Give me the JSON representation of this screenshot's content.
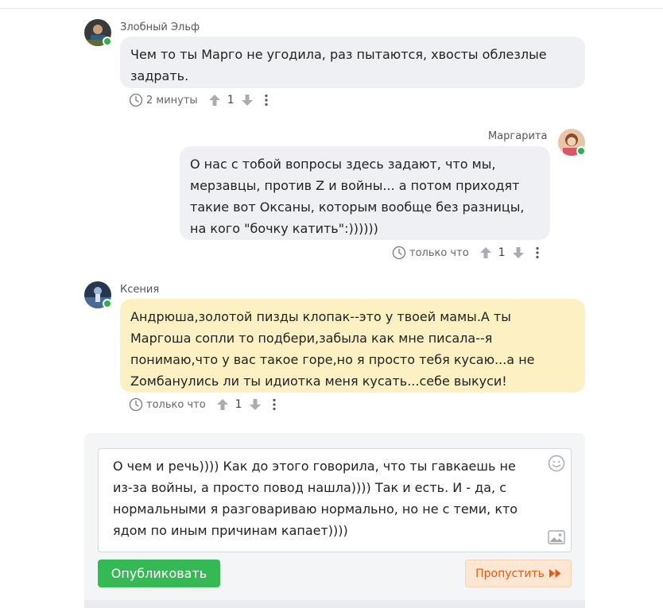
{
  "comments": [
    {
      "author": "Злобный Эльф",
      "text": "Чем то ты Марго не угодила, раз пытаются, хвосты облезлые задрать.",
      "time": "2 минуты",
      "votes": "1",
      "align": "left",
      "bubble_color": "#eef0f3"
    },
    {
      "author": "Маргарита",
      "text": "О нас с тобой вопросы здесь задают, что мы, мерзавцы, против Z и войны... а потом приходят такие вот Оксаны, которым вообще без разницы, на кого \"бочку катить\":))))))",
      "time": "только что",
      "votes": "1",
      "align": "right",
      "bubble_color": "#eef0f3"
    },
    {
      "author": "Ксения",
      "text": "Андрюша,золотой пизды клопак--это у твоей мамы.А ты Маргоша сопли то подбери,забыла как мне писала--я понимаю,что у вас такое горе,но я просто тебя кусаю...а не Zомбанулись ли ты идиотка меня кусать...себе выкуси!",
      "time": "только что",
      "votes": "1",
      "align": "left",
      "bubble_color": "#fdf1c3"
    }
  ],
  "composer": {
    "text": "О чем и речь)))) Как до этого говорила, что ты гавкаешь не из-за войны, а просто повод нашла)))) Так и есть. И - да, с нормальными я разговариваю нормально, но не с теми, кто ядом по иным причинам капает))))",
    "publish_label": "Опубликовать",
    "skip_label": "Пропустить"
  },
  "colors": {
    "accent_green": "#35b955",
    "skip_orange": "#e55a12",
    "online": "#2bb24c"
  },
  "icons": {
    "clock": "clock-icon",
    "upvote": "arrow-up-icon",
    "downvote": "arrow-down-icon",
    "more": "more-vertical-icon",
    "emoji": "emoji-icon",
    "image": "image-icon",
    "skip": "fast-forward-icon"
  }
}
